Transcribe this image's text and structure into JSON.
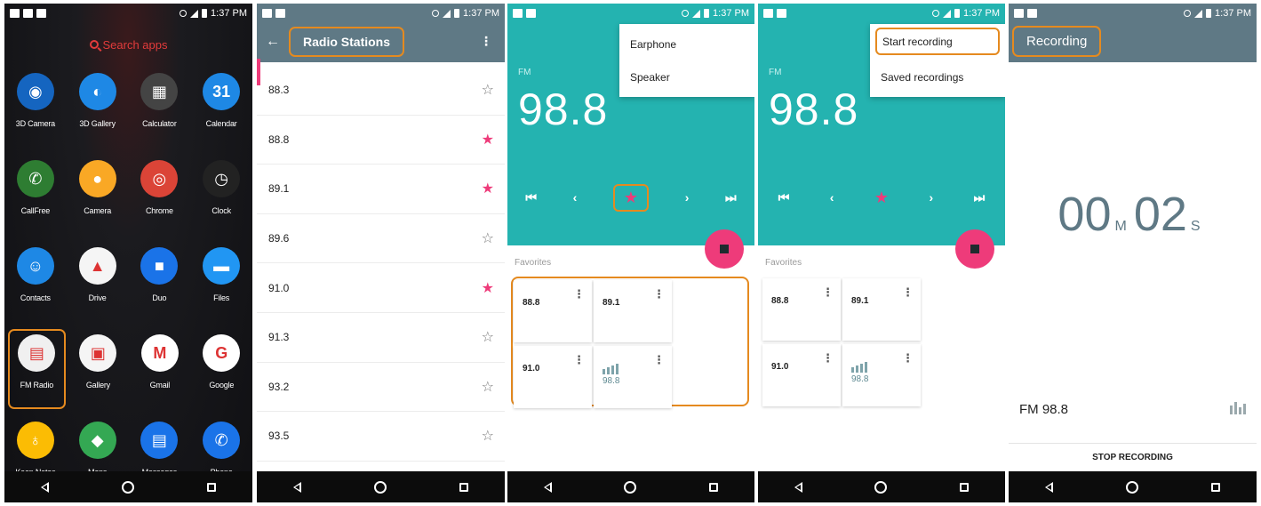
{
  "status": {
    "time": "1:37 PM"
  },
  "screen1": {
    "search_label": "Search apps",
    "apps": [
      {
        "name": "3D Camera",
        "icon": "3d-camera-icon",
        "color": "#1565c0",
        "glyph": "◉"
      },
      {
        "name": "3D Gallery",
        "icon": "3d-gallery-icon",
        "color": "#1e88e5",
        "glyph": "◐"
      },
      {
        "name": "Calculator",
        "icon": "calculator-icon",
        "color": "#444444",
        "glyph": "▦"
      },
      {
        "name": "Calendar",
        "icon": "calendar-icon",
        "color": "#1e88e5",
        "glyph": "31"
      },
      {
        "name": "CallFree",
        "icon": "callfree-icon",
        "color": "#2e7d32",
        "glyph": "✆"
      },
      {
        "name": "Camera",
        "icon": "camera-icon",
        "color": "#f9a825",
        "glyph": "●"
      },
      {
        "name": "Chrome",
        "icon": "chrome-icon",
        "color": "#db4437",
        "glyph": "◎"
      },
      {
        "name": "Clock",
        "icon": "clock-icon",
        "color": "#222222",
        "glyph": "◷"
      },
      {
        "name": "Contacts",
        "icon": "contacts-icon",
        "color": "#1e88e5",
        "glyph": "☺"
      },
      {
        "name": "Drive",
        "icon": "drive-icon",
        "color": "#f5f5f5",
        "glyph": "▲"
      },
      {
        "name": "Duo",
        "icon": "duo-icon",
        "color": "#1a73e8",
        "glyph": "■"
      },
      {
        "name": "Files",
        "icon": "files-icon",
        "color": "#2196f3",
        "glyph": "▬"
      },
      {
        "name": "FM Radio",
        "icon": "fm-radio-icon",
        "color": "#f0f0f0",
        "glyph": "▤"
      },
      {
        "name": "Gallery",
        "icon": "gallery-icon",
        "color": "#f5f5f5",
        "glyph": "▣"
      },
      {
        "name": "Gmail",
        "icon": "gmail-icon",
        "color": "#ffffff",
        "glyph": "M"
      },
      {
        "name": "Google",
        "icon": "google-icon",
        "color": "#ffffff",
        "glyph": "G"
      },
      {
        "name": "Keep Notes",
        "icon": "keep-notes-icon",
        "color": "#fbbc04",
        "glyph": "♁"
      },
      {
        "name": "Maps",
        "icon": "maps-icon",
        "color": "#34a853",
        "glyph": "◆"
      },
      {
        "name": "Messages",
        "icon": "messages-icon",
        "color": "#1a73e8",
        "glyph": "▤"
      },
      {
        "name": "Phone",
        "icon": "phone-icon",
        "color": "#1a73e8",
        "glyph": "✆"
      }
    ]
  },
  "screen2": {
    "title": "Radio Stations",
    "stations": [
      {
        "freq": "88.3",
        "fav": false
      },
      {
        "freq": "88.8",
        "fav": true
      },
      {
        "freq": "89.1",
        "fav": true
      },
      {
        "freq": "89.6",
        "fav": false
      },
      {
        "freq": "91.0",
        "fav": true
      },
      {
        "freq": "91.3",
        "fav": false
      },
      {
        "freq": "93.2",
        "fav": false
      },
      {
        "freq": "93.5",
        "fav": false
      }
    ]
  },
  "screen3": {
    "band": "FM",
    "frequency": "98.8",
    "menu": [
      "Earphone",
      "Speaker"
    ],
    "favorites_label": "Favorites",
    "favorites": [
      "88.8",
      "89.1",
      "91.0"
    ],
    "playing": "98.8"
  },
  "screen4": {
    "band": "FM",
    "frequency": "98.8",
    "menu": [
      "Start recording",
      "Saved recordings"
    ],
    "favorites_label": "Favorites",
    "favorites": [
      "88.8",
      "89.1",
      "91.0"
    ],
    "playing": "98.8"
  },
  "screen5": {
    "title": "Recording",
    "minutes": "00",
    "minutes_unit": "M",
    "seconds": "02",
    "seconds_unit": "S",
    "station": "FM 98.8",
    "stop_label": "STOP RECORDING"
  },
  "colors": {
    "accent": "#24b3b0",
    "pink": "#ee3b7a",
    "appbar": "#5f7985",
    "highlight": "#e58a1f"
  }
}
